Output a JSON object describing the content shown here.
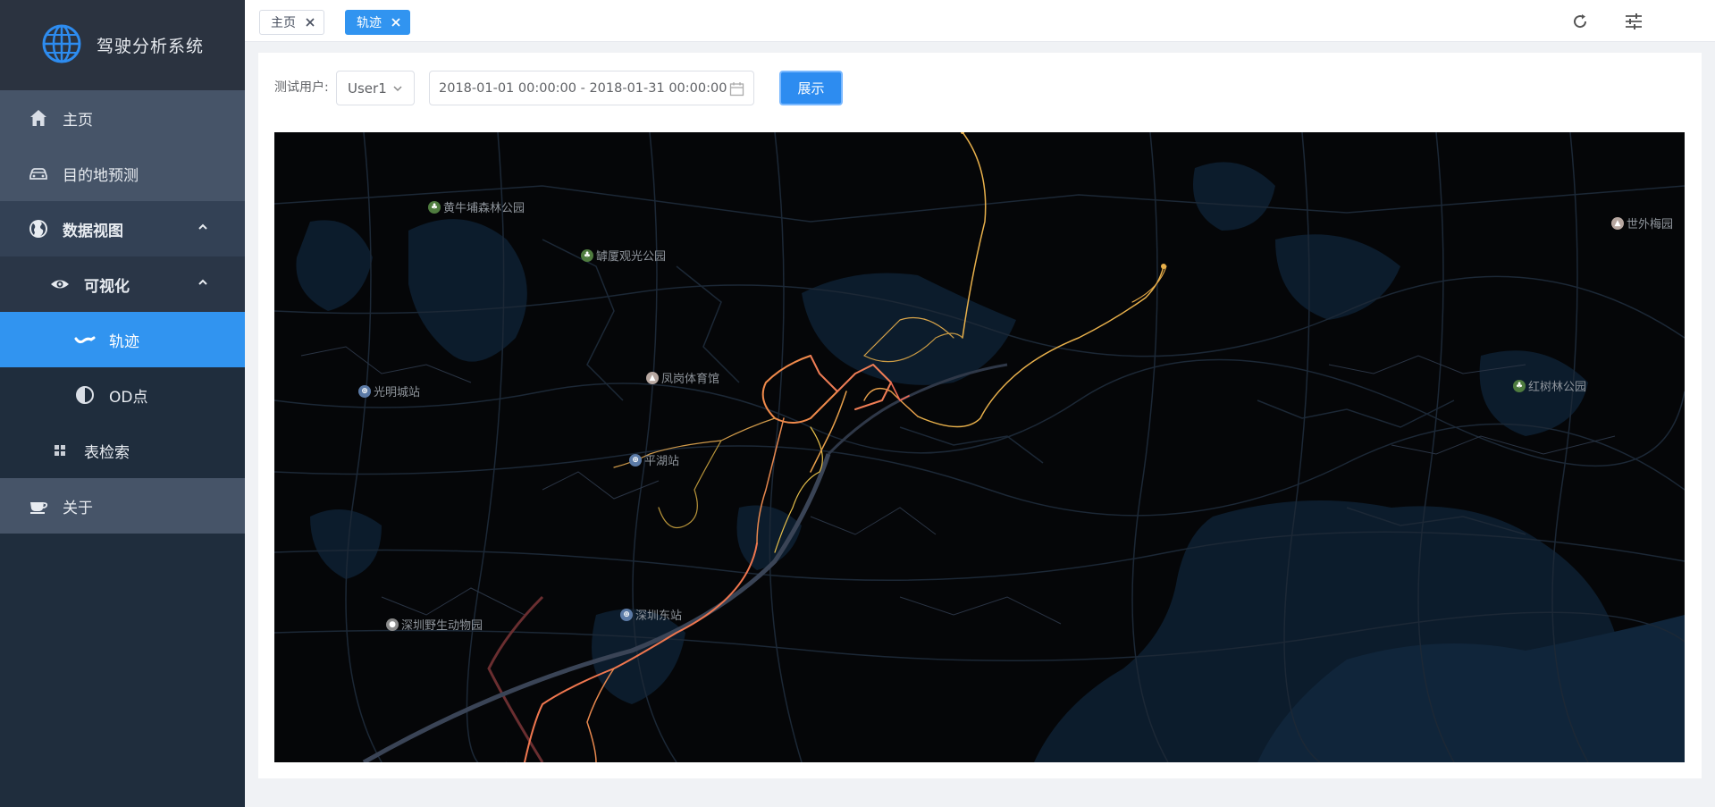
{
  "app": {
    "title": "驾驶分析系统"
  },
  "sidebar": {
    "items": [
      {
        "label": "主页",
        "icon": "home-icon"
      },
      {
        "label": "目的地预测",
        "icon": "car-icon"
      },
      {
        "label": "数据视图",
        "icon": "globe-icon",
        "expanded": true
      },
      {
        "label": "可视化",
        "icon": "eye-icon",
        "expanded": true
      },
      {
        "label": "轨迹",
        "icon": "wave-icon",
        "active": true
      },
      {
        "label": "OD点",
        "icon": "half-circle-icon"
      },
      {
        "label": "表检索",
        "icon": "grid-icon"
      },
      {
        "label": "关于",
        "icon": "cup-icon"
      }
    ]
  },
  "tabs": [
    {
      "label": "主页",
      "active": false
    },
    {
      "label": "轨迹",
      "active": true
    }
  ],
  "filter": {
    "user_label": "测试用户:",
    "user_value": "User1",
    "date_range": "2018-01-01 00:00:00 - 2018-01-31 00:00:00",
    "submit_label": "展示"
  },
  "map": {
    "pois": [
      {
        "label": "黄牛埔森林公园",
        "type": "park"
      },
      {
        "label": "罅厦观光公园",
        "type": "park"
      },
      {
        "label": "光明城站",
        "type": "station"
      },
      {
        "label": "凤岗体育馆",
        "type": "venue"
      },
      {
        "label": "平湖站",
        "type": "station"
      },
      {
        "label": "深圳东站",
        "type": "station"
      },
      {
        "label": "深圳野生动物园",
        "type": "zoo"
      },
      {
        "label": "世外梅园",
        "type": "venue"
      },
      {
        "label": "红树林公园",
        "type": "park"
      }
    ]
  },
  "colors": {
    "accent": "#3194f0",
    "sidebar": "#1f2d3d",
    "map_bg": "#050608",
    "trajectory_warm": "#f08a4b",
    "trajectory_yellow": "#e8b04b"
  }
}
